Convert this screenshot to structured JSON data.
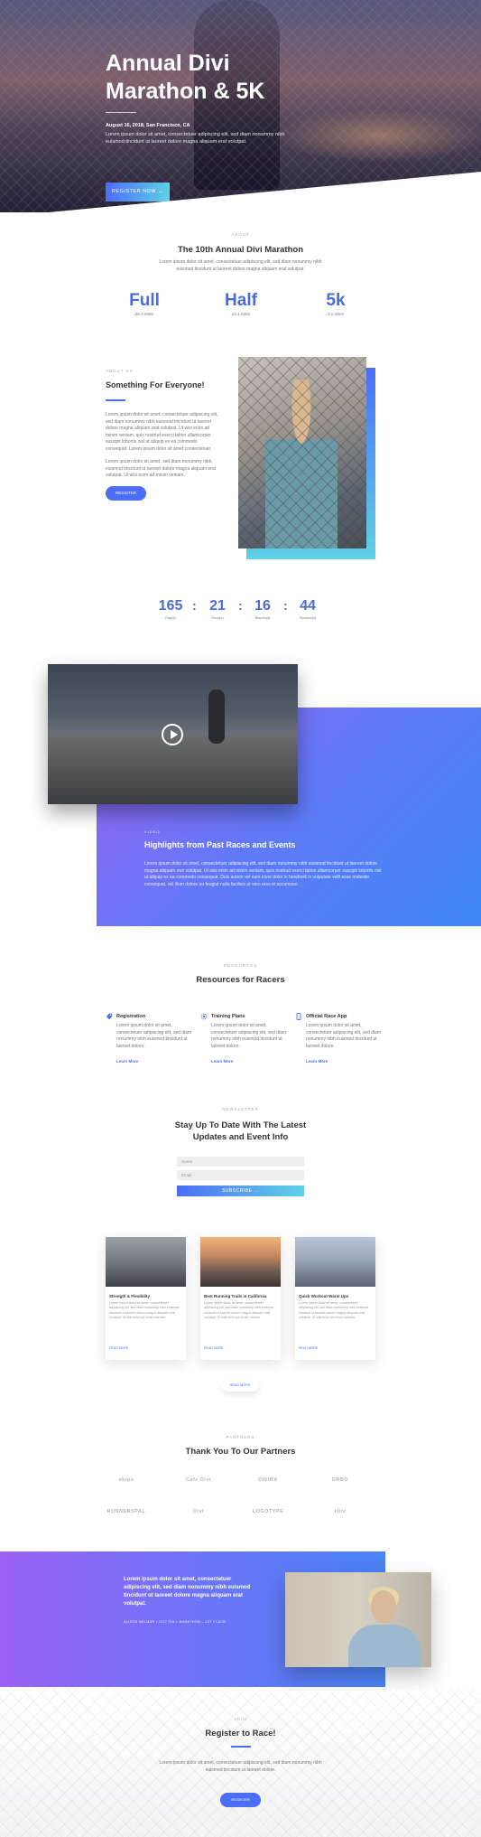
{
  "hero": {
    "title": "Annual Divi Marathon & 5K",
    "date": "August 16, 2018, San Francisco, CA",
    "desc": "Lorem ipsum dolor sit amet, consectetuer adipiscing elit, sed diam nonummy nibh euismod tincidunt ut laoreet dolore magna aliquam erat volutpat.",
    "button": "REGISTER NOW →"
  },
  "about": {
    "eyebrow": "ABOUT",
    "title": "The 10th Annual Divi Marathon",
    "desc": "Lorem ipsum dolor sit amet, consectetuer adipiscing elit, sed diam nonummy nibh euismod tincidunt ut laoreet dolore magna aliquam erat volutpat.",
    "stats": [
      {
        "value": "Full",
        "sub": "26.2 miles"
      },
      {
        "value": "Half",
        "sub": "13.1 miles"
      },
      {
        "value": "5k",
        "sub": "3.1 miles"
      }
    ]
  },
  "everyone": {
    "eyebrow": "ABOUT US",
    "title": "Something For Everyone!",
    "p1": "Lorem ipsum dolor sit amet, consectetuer adipiscing elit, sed diam nonummy nibh euismod tincidunt ut laoreet dolore magna aliquam erat volutpat. Ut wisi enim ad minim veniam, quis nostrud exerci tation ullamcorper suscipit lobortis nisl ut aliquip ex ea commodo consequat. Lorem ipsum dolor sit amet consectetuer.",
    "p2": "Lorem ipsum dolor sit amet, sed diam nonummy nibh euismod tincidunt ut laoreet dolore magna aliquam erat volutpat. Ut wisi enim ad minim veniam.",
    "button": "REGISTER"
  },
  "countdown": [
    {
      "value": "165",
      "label": "Day(s)"
    },
    {
      "value": "21",
      "label": "Hour(s)"
    },
    {
      "value": "16",
      "label": "Minute(s)"
    },
    {
      "value": "44",
      "label": "Second(s)"
    }
  ],
  "highlights": {
    "eyebrow": "VIDEO",
    "title": "Highlights from Past Races and Events",
    "desc": "Lorem ipsum dolor sit amet, consectetuer adipiscing elit, sed diam nonummy nibh euismod tincidunt ut laoreet dolore magna aliquam erat volutpat. Ut wisi enim ad minim veniam, quis nostrud exerci tation ullamcorper suscipit lobortis nisl ut aliquip ex ea commodo consequat. Duis autem vel eum iriure dolor in hendrerit in vulputate velit esse molestie consequat, vel illum dolore eu feugiat nulla facilisis at vero eros et accumsan."
  },
  "resources": {
    "eyebrow": "RESOURCES",
    "title": "Resources for Racers",
    "items": [
      {
        "title": "Registration",
        "desc": "Lorem ipsum dolor sit amet, consectetuer adipiscing elit, sed diam nonummy nibh euismod tincidunt ut laoreet dolore.",
        "link": "Learn More"
      },
      {
        "title": "Training Plans",
        "desc": "Lorem ipsum dolor sit amet, consectetuer adipiscing elit, sed diam nonummy nibh euismod tincidunt ut laoreet dolore.",
        "link": "Learn More"
      },
      {
        "title": "Official Race App",
        "desc": "Lorem ipsum dolor sit amet, consectetuer adipiscing elit, sed diam nonummy nibh euismod tincidunt ut laoreet dolore.",
        "link": "Learn More"
      }
    ]
  },
  "newsletter": {
    "eyebrow": "NEWSLETTER",
    "title": "Stay Up To Date With The Latest Updates and Event Info",
    "name_placeholder": "Name",
    "email_placeholder": "Email",
    "button": "SUBSCRIBE →"
  },
  "blog": {
    "cards": [
      {
        "title": "Strength & Flexibility",
        "desc": "Lorem ipsum dolor sit amet, consectetuer adipiscing elit, sed diam nonummy nibh euismod tincidunt ut laoreet dolore magna aliquam erat volutpat. Ut wisi enim ad minim veniam.",
        "link": "READ MORE"
      },
      {
        "title": "Best Running Trails in California",
        "desc": "Lorem ipsum dolor sit amet, consectetuer adipiscing elit, sed diam nonummy nibh euismod tincidunt ut laoreet dolore magna aliquam erat volutpat. Ut wisi enim ad minim veniam.",
        "link": "READ MORE"
      },
      {
        "title": "Quick Workout Warm Ups",
        "desc": "Lorem ipsum dolor sit amet, consectetuer adipiscing elit, sed diam nonummy nibh euismod tincidunt ut laoreet dolore magna aliquam erat volutpat. Ut wisi enim ad minim veniam.",
        "link": "READ MORE"
      }
    ],
    "read_more": "READ MORE"
  },
  "partners": {
    "eyebrow": "PARTNERS",
    "title": "Thank You To Our Partners",
    "logos": [
      "ekipo",
      "Cafe Divi",
      "DIVIRA",
      "DRBO",
      "RUNNERSPAL",
      "Divi",
      "LOGOTYPE",
      "elite"
    ]
  },
  "testimonial": {
    "quote": "Lorem ipsum dolor sit amet, consectetuer adipiscing elit, sed diam nonummy nibh euismod tincidunt ut laoreet dolore magna aliquam erat volutpat.",
    "author": "ALISON BELMAR | 2017 FULL MARATHON – 1ST PLACE"
  },
  "register": {
    "eyebrow": "JOIN",
    "title": "Register to Race!",
    "desc": "Lorem ipsum dolor sit amet, consectetuer adipiscing elit, sed diam nonummy nibh euismod tincidunt ut laoreet dolore.",
    "button": "REGISTER"
  },
  "colors": {
    "accent": "#4c6ef5",
    "cyan": "#5fd2e6",
    "purple": "#9b63f5"
  }
}
